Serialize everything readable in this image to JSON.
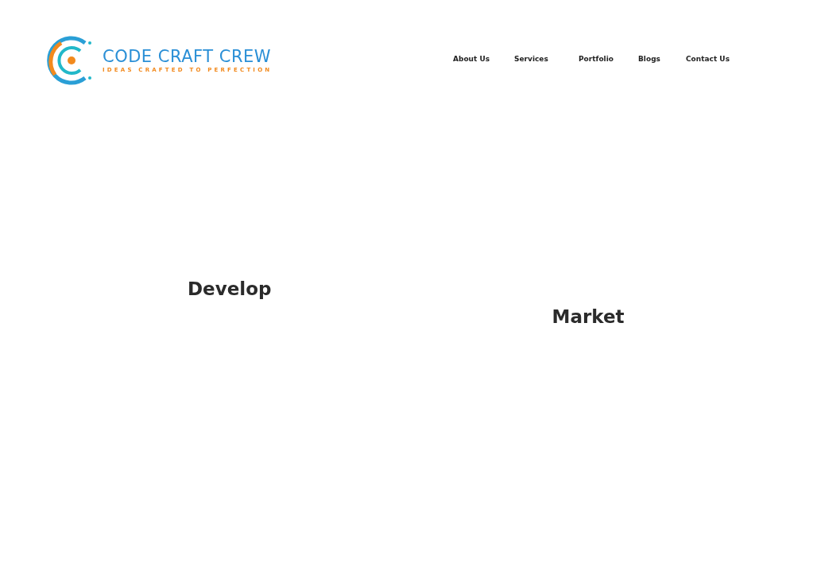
{
  "logo": {
    "name": "CODE CRAFT CREW",
    "tagline": "IDEAS CRAFTED TO PERFECTION"
  },
  "nav": [
    {
      "label": "About Us"
    },
    {
      "label": "Services"
    },
    {
      "label": "Portfolio"
    },
    {
      "label": "Blogs"
    },
    {
      "label": "Contact Us"
    }
  ],
  "sections": [
    {
      "heading": "Develop"
    },
    {
      "heading": "Market"
    }
  ]
}
